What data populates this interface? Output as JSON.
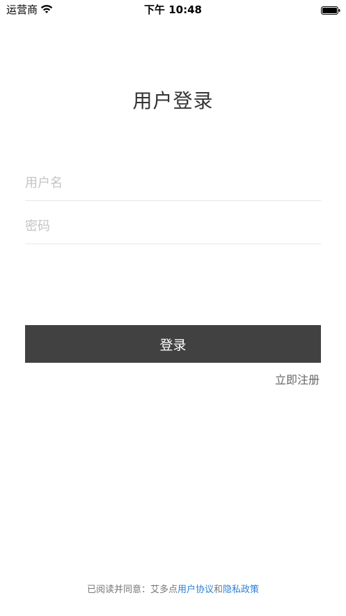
{
  "status_bar": {
    "carrier": "运营商",
    "time": "下午 10:48"
  },
  "title": "用户登录",
  "form": {
    "username_placeholder": "用户名",
    "password_placeholder": "密码"
  },
  "login_button_label": "登录",
  "register_label": "立即注册",
  "agreement": {
    "prefix": "已阅读并同意：艾多点",
    "user_agreement": "用户协议",
    "conjunction": "和",
    "privacy_policy": "隐私政策"
  },
  "icons": {
    "wifi": "wifi-icon",
    "battery": "battery-icon"
  },
  "colors": {
    "button_bg": "#414141",
    "link": "#2b7fd6",
    "placeholder": "#c4c4c4"
  }
}
